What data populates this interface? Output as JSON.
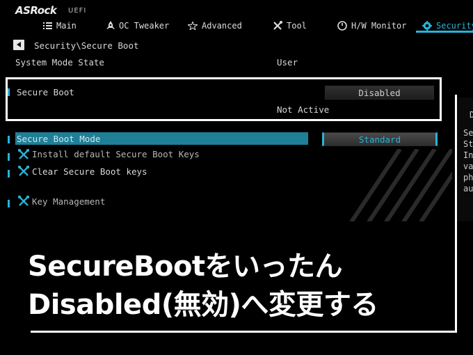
{
  "header": {
    "brand": "ASRock",
    "brand_sub": "UEFI",
    "tabs": [
      {
        "label": "Main",
        "icon": "list-icon"
      },
      {
        "label": "OC Tweaker",
        "icon": "rocket-icon"
      },
      {
        "label": "Advanced",
        "icon": "star-icon"
      },
      {
        "label": "Tool",
        "icon": "tools-icon"
      },
      {
        "label": "H/W Monitor",
        "icon": "monitor-circle-icon"
      },
      {
        "label": "Security",
        "icon": "gear-shield-icon"
      }
    ],
    "active_tab": "Security",
    "accent_color": "#27b4d8"
  },
  "breadcrumb": "Security\\Secure Boot",
  "settings": {
    "system_mode_label": "System Mode State",
    "system_mode_value": "User",
    "secure_boot_label": "Secure Boot",
    "secure_boot_value": "Disabled",
    "secure_boot_status": "Not Active",
    "secure_boot_mode_label": "Secure Boot Mode",
    "secure_boot_mode_value": "Standard",
    "install_keys_label": "Install default Secure Boot Keys",
    "clear_keys_label": "Clear Secure Boot keys",
    "key_management_label": "Key Management"
  },
  "help_panel": {
    "heading": "D",
    "lines": [
      "Sec",
      "St",
      "In",
      "va",
      "ph",
      "au"
    ]
  },
  "caption": {
    "line1": "SecureBootをいったん",
    "line2": "Disabled(無効)へ変更する"
  }
}
